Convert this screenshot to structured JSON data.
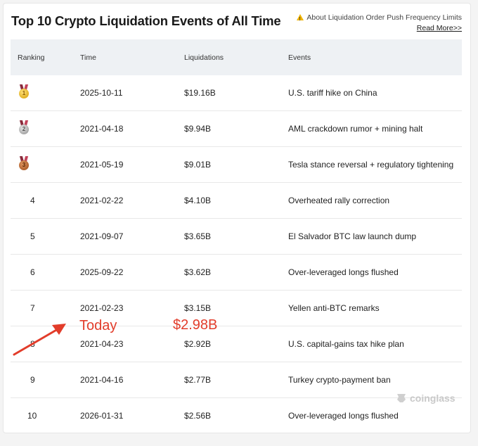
{
  "title": "Top 10 Crypto Liquidation Events of All Time",
  "notice": {
    "text": "About Liquidation Order Push Frequency Limits",
    "read_more": "Read More>>"
  },
  "table": {
    "headers": [
      "Ranking",
      "Time",
      "Liquidations",
      "Events"
    ],
    "rows": [
      {
        "rank": "1",
        "time": "2025-10-11",
        "liquidations": "$19.16B",
        "event": "U.S. tariff hike on China"
      },
      {
        "rank": "2",
        "time": "2021-04-18",
        "liquidations": "$9.94B",
        "event": "AML crackdown rumor + mining halt"
      },
      {
        "rank": "3",
        "time": "2021-05-19",
        "liquidations": "$9.01B",
        "event": "Tesla stance reversal + regulatory tightening"
      },
      {
        "rank": "4",
        "time": "2021-02-22",
        "liquidations": "$4.10B",
        "event": "Overheated rally correction"
      },
      {
        "rank": "5",
        "time": "2021-09-07",
        "liquidations": "$3.65B",
        "event": "El Salvador BTC law launch dump"
      },
      {
        "rank": "6",
        "time": "2025-09-22",
        "liquidations": "$3.62B",
        "event": "Over-leveraged longs flushed"
      },
      {
        "rank": "7",
        "time": "2021-02-23",
        "liquidations": "$3.15B",
        "event": "Yellen anti-BTC remarks"
      },
      {
        "rank": "8",
        "time": "2021-04-23",
        "liquidations": "$2.92B",
        "event": "U.S. capital-gains tax hike plan"
      },
      {
        "rank": "9",
        "time": "2021-04-16",
        "liquidations": "$2.77B",
        "event": "Turkey crypto-payment ban"
      },
      {
        "rank": "10",
        "time": "2026-01-31",
        "liquidations": "$2.56B",
        "event": "Over-leveraged longs flushed"
      }
    ]
  },
  "annotation": {
    "today_label": "Today",
    "today_value": "$2.98B",
    "color": "#e23c2a"
  },
  "watermark": "coinglass",
  "icons": {
    "notice": "warning-icon",
    "rank1": "gold-medal-icon",
    "rank2": "silver-medal-icon",
    "rank3": "bronze-medal-icon",
    "watermark": "coinglass-logo-icon"
  }
}
